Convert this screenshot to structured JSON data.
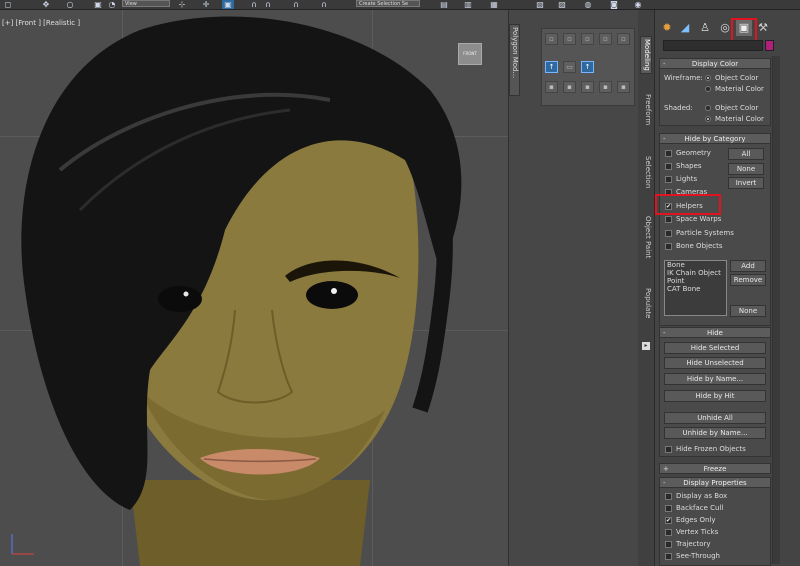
{
  "toolbar": {
    "view_dropdown": "View",
    "selection_set_placeholder": "Create Selection Se"
  },
  "viewport": {
    "label": "[+] [Front ] [Realistic ]",
    "viewcube_label": "FRONT"
  },
  "ribbon": {
    "vertical_tab": "Polygon Mod..."
  },
  "side_tabs": [
    "Modeling",
    "Freeform",
    "Selection",
    "Object Paint",
    "Populate"
  ],
  "command_panel": {
    "tab_icons": [
      "sun-icon",
      "hierarchy-icon",
      "motion-icon",
      "display-icon",
      "utilities-icon"
    ],
    "display_color": {
      "title": "Display Color",
      "wireframe_label": "Wireframe:",
      "shaded_label": "Shaded:",
      "options": [
        "Object Color",
        "Material Color"
      ],
      "wireframe_selected": "Object Color",
      "shaded_selected": "Material Color"
    },
    "hide_by_category": {
      "title": "Hide by Category",
      "categories": [
        {
          "label": "Geometry",
          "checked": false
        },
        {
          "label": "Shapes",
          "checked": false
        },
        {
          "label": "Lights",
          "checked": false
        },
        {
          "label": "Cameras",
          "checked": false
        },
        {
          "label": "Helpers",
          "checked": true
        },
        {
          "label": "Space Warps",
          "checked": false
        },
        {
          "label": "Particle Systems",
          "checked": false
        },
        {
          "label": "Bone Objects",
          "checked": false
        }
      ],
      "all_label": "All",
      "none_label": "None",
      "invert_label": "Invert",
      "list_items": [
        "Bone",
        "IK Chain Object",
        "Point",
        "CAT Bone"
      ],
      "add_label": "Add",
      "remove_label": "Remove",
      "list_none_label": "None"
    },
    "hide": {
      "title": "Hide",
      "buttons": [
        "Hide Selected",
        "Hide Unselected",
        "Hide by Name...",
        "Hide by Hit",
        "Unhide All",
        "Unhide by Name..."
      ],
      "hide_frozen_label": "Hide Frozen Objects"
    },
    "freeze": {
      "title": "Freeze"
    },
    "display_properties": {
      "title": "Display Properties",
      "items": [
        {
          "label": "Display as Box",
          "checked": false
        },
        {
          "label": "Backface Cull",
          "checked": false
        },
        {
          "label": "Edges Only",
          "checked": true
        },
        {
          "label": "Vertex Ticks",
          "checked": false
        },
        {
          "label": "Trajectory",
          "checked": false
        },
        {
          "label": "See-Through",
          "checked": false
        }
      ]
    }
  },
  "colors": {
    "highlight": "#e0141e",
    "skin": "#8c7a3a",
    "hair": "#141414"
  }
}
